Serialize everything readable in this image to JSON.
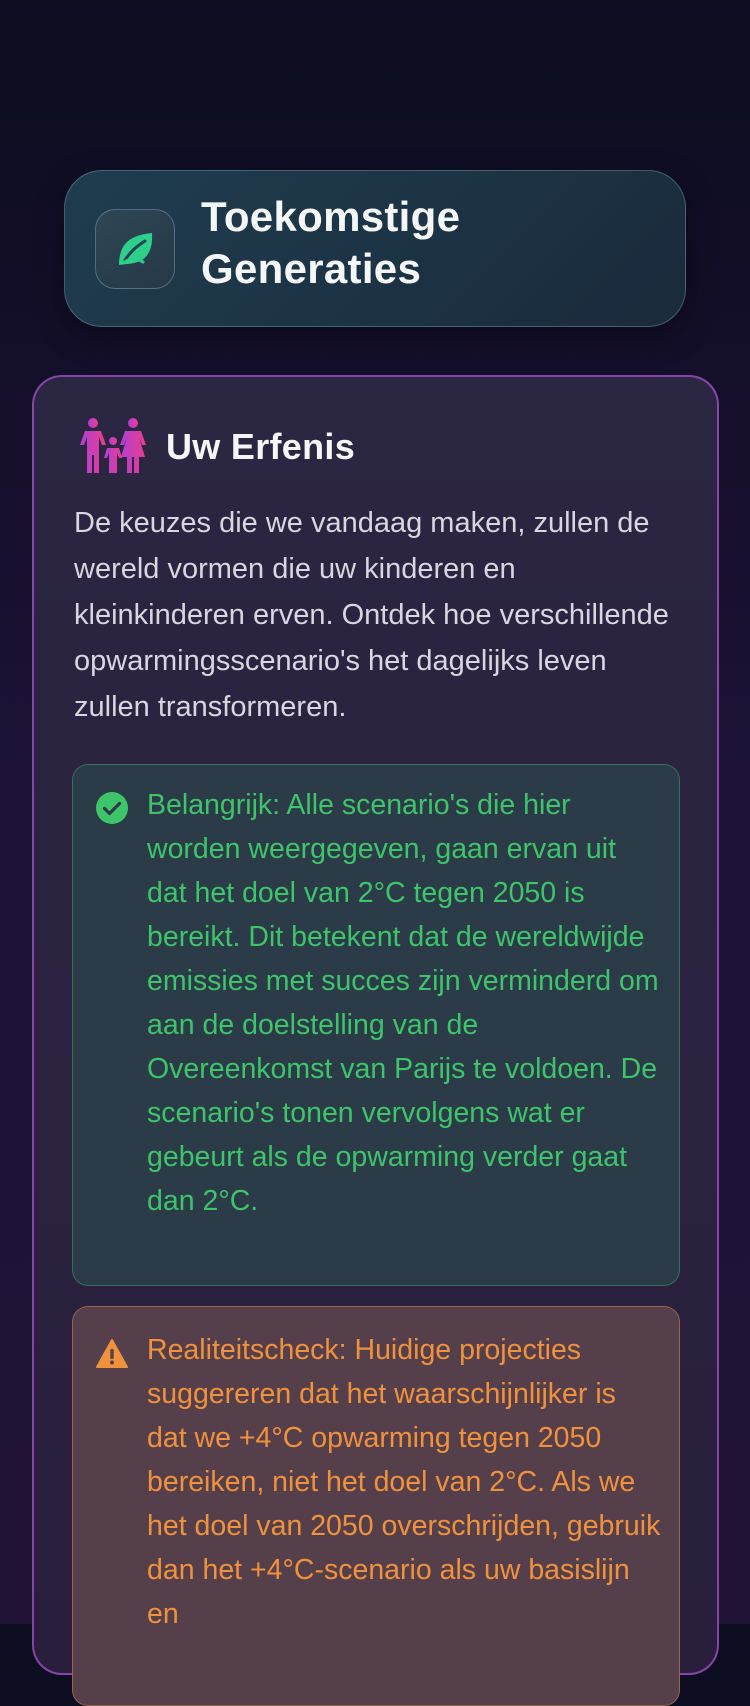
{
  "header": {
    "icon": "leaf-icon",
    "title": "Toekomstige Generaties"
  },
  "legacy_card": {
    "icon": "family-icon",
    "title": "Uw Erfenis",
    "description": "De keuzes die we vandaag maken, zullen de wereld vormen die uw kinderen en kleinkinderen erven. Ontdek hoe verschillende opwarmingsscenario's het dagelijks leven zullen transformeren.",
    "important_note": {
      "icon": "check-circle-icon",
      "text": "Belangrijk: Alle scenario's die hier worden weergegeven, gaan ervan uit dat het doel van 2°C tegen 2050 is bereikt. Dit betekent dat de wereldwijde emissies met succes zijn verminderd om aan de doelstelling van de Overeenkomst van Parijs te voldoen. De scenario's tonen vervolgens wat er gebeurt als de opwarming verder gaat dan 2°C."
    },
    "reality_check": {
      "icon": "warning-icon",
      "text": "Realiteitscheck: Huidige projecties suggereren dat het waarschijnlijker is dat we +4°C opwarming tegen 2050 bereiken, niet het doel van 2°C. Als we het doel van 2050 overschrijden, gebruik dan het +4°C-scenario als uw basislijn en"
    }
  },
  "colors": {
    "accent_green": "#3ec46a",
    "accent_orange": "#f0923d",
    "card_border_purple": "#a850cd",
    "family_icon_pink": "#e83e8c",
    "family_icon_purple": "#b03fd6"
  }
}
